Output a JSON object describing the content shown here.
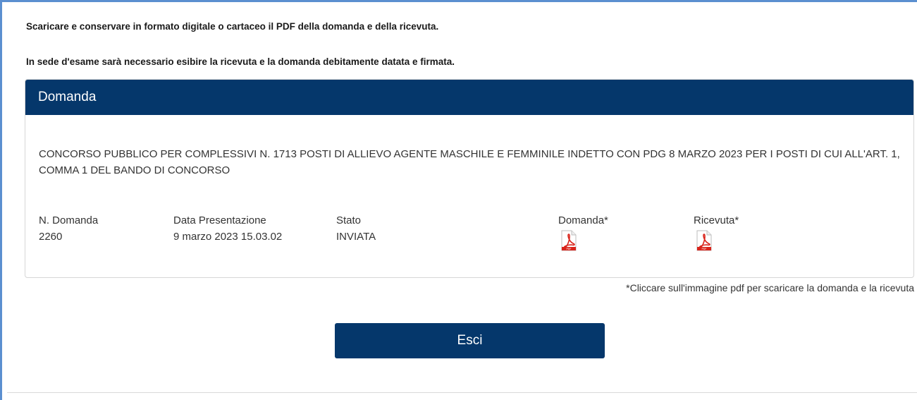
{
  "notices": [
    "Scaricare e conservare in formato digitale o cartaceo il PDF della domanda e della ricevuta.",
    "In sede d'esame sarà necessario esibire la ricevuta e la domanda debitamente datata e firmata."
  ],
  "panel": {
    "title": "Domanda",
    "concorso": "CONCORSO PUBBLICO PER COMPLESSIVI N. 1713 POSTI DI ALLIEVO AGENTE MASCHILE E FEMMINILE INDETTO CON PDG 8 MARZO 2023 PER I POSTI DI CUI ALL'ART. 1, COMMA 1 DEL BANDO DI CONCORSO",
    "fields": {
      "numero_label": "N. Domanda",
      "numero_value": "2260",
      "data_label": "Data Presentazione",
      "data_value": "9 marzo 2023 15.03.02",
      "stato_label": "Stato",
      "stato_value": "INVIATA",
      "domanda_label": "Domanda*",
      "ricevuta_label": "Ricevuta*"
    },
    "icons": {
      "domanda": "pdf-icon",
      "ricevuta": "pdf-icon"
    }
  },
  "footnote": "*Cliccare sull'immagine pdf per scaricare la domanda e la ricevuta",
  "exit_button": "Esci",
  "colors": {
    "primary": "#05376b",
    "frame": "#5b8fd0",
    "pdf_red": "#d9241b"
  }
}
